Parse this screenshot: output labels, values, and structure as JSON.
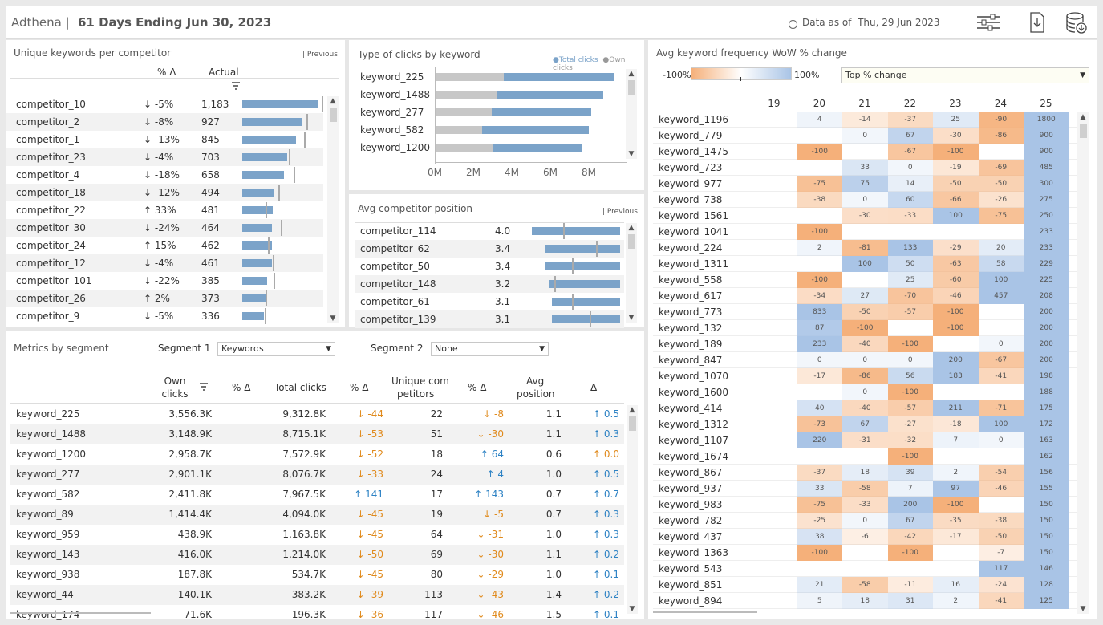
{
  "header": {
    "brand": "Adthena |",
    "date_range": "61 Days Ending Jun 30, 2023",
    "data_as_of_label": "Data as of",
    "data_as_of_date": "Thu, 29 Jun 2023",
    "icons": [
      "filter-sliders-icon",
      "download-pdf-icon",
      "database-download-icon"
    ]
  },
  "unique_keywords": {
    "title": "Unique keywords per competitor",
    "previous_label": "| Previous",
    "col_pct": "% Δ",
    "col_actual": "Actual",
    "max": 1183,
    "rows": [
      {
        "name": "competitor_10",
        "pct": "↓ -5%",
        "actual": "1,183",
        "value": 1183,
        "prev": 1245
      },
      {
        "name": "competitor_2",
        "pct": "↓ -8%",
        "actual": "927",
        "value": 927,
        "prev": 1008
      },
      {
        "name": "competitor_1",
        "pct": "↓ -13%",
        "actual": "845",
        "value": 845,
        "prev": 971
      },
      {
        "name": "competitor_23",
        "pct": "↓ -4%",
        "actual": "703",
        "value": 703,
        "prev": 732
      },
      {
        "name": "competitor_4",
        "pct": "↓ -18%",
        "actual": "658",
        "value": 658,
        "prev": 802
      },
      {
        "name": "competitor_18",
        "pct": "↓ -12%",
        "actual": "494",
        "value": 494,
        "prev": 561
      },
      {
        "name": "competitor_22",
        "pct": "↑ 33%",
        "actual": "481",
        "value": 481,
        "prev": 362
      },
      {
        "name": "competitor_30",
        "pct": "↓ -24%",
        "actual": "464",
        "value": 464,
        "prev": 610
      },
      {
        "name": "competitor_24",
        "pct": "↑ 15%",
        "actual": "462",
        "value": 462,
        "prev": 402
      },
      {
        "name": "competitor_12",
        "pct": "↓ -4%",
        "actual": "461",
        "value": 461,
        "prev": 480
      },
      {
        "name": "competitor_101",
        "pct": "↓ -22%",
        "actual": "385",
        "value": 385,
        "prev": 494
      },
      {
        "name": "competitor_26",
        "pct": "↑ 2%",
        "actual": "373",
        "value": 373,
        "prev": 366
      },
      {
        "name": "competitor_9",
        "pct": "↓ -5%",
        "actual": "336",
        "value": 336,
        "prev": 354
      }
    ]
  },
  "clicks_type": {
    "title": "Type of clicks by keyword",
    "legend_total": "●Total clicks",
    "legend_own": "●Own clicks",
    "ticks": [
      "0M",
      "2M",
      "4M",
      "6M",
      "8M"
    ],
    "tick_values": [
      0,
      2,
      4,
      6,
      8
    ],
    "xmax": 10,
    "rows": [
      {
        "name": "keyword_225",
        "own": 3.56,
        "total": 9.31
      },
      {
        "name": "keyword_1488",
        "own": 3.15,
        "total": 8.72
      },
      {
        "name": "keyword_277",
        "own": 2.9,
        "total": 8.08
      },
      {
        "name": "keyword_582",
        "own": 2.41,
        "total": 7.97
      },
      {
        "name": "keyword_1200",
        "own": 2.96,
        "total": 7.57
      }
    ]
  },
  "avg_position": {
    "title": "Avg competitor position",
    "previous_label": "| Previous",
    "max": 4.0,
    "rows": [
      {
        "name": "competitor_114",
        "value_label": "4.0",
        "value": 4.0,
        "prev": 1.4
      },
      {
        "name": "competitor_62",
        "value_label": "3.4",
        "value": 3.4,
        "prev": 2.9
      },
      {
        "name": "competitor_50",
        "value_label": "3.4",
        "value": 3.4,
        "prev": 1.8
      },
      {
        "name": "competitor_148",
        "value_label": "3.2",
        "value": 3.2,
        "prev": 1.0
      },
      {
        "name": "competitor_61",
        "value_label": "3.1",
        "value": 3.1,
        "prev": 1.8
      },
      {
        "name": "competitor_139",
        "value_label": "3.1",
        "value": 3.1,
        "prev": 2.6
      }
    ]
  },
  "metrics": {
    "title": "Metrics by segment",
    "segment1_label": "Segment 1",
    "segment1_value": "Keywords",
    "segment2_label": "Segment 2",
    "segment2_value": "None",
    "cols": {
      "own1": "Own",
      "own2": "clicks",
      "pct": "% Δ",
      "total": "Total clicks",
      "pct2": "% Δ",
      "uniq1": "Unique com",
      "uniq2": "petitors",
      "pct3": "% Δ",
      "avg1": "Avg",
      "avg2": "position",
      "delta": "Δ"
    },
    "rows": [
      {
        "name": "keyword_225",
        "own": "3,556.3K",
        "total": "9,312.8K",
        "tp": "↓ -44",
        "td": "d",
        "u": "22",
        "up": "↓ -8",
        "ud": "d",
        "avg": "1.1",
        "ad": "↑ 0.5",
        "adc": "u"
      },
      {
        "name": "keyword_1488",
        "own": "3,148.9K",
        "total": "8,715.1K",
        "tp": "↓ -53",
        "td": "d",
        "u": "51",
        "up": "↓ -30",
        "ud": "d",
        "avg": "1.1",
        "ad": "↑ 0.3",
        "adc": "u"
      },
      {
        "name": "keyword_1200",
        "own": "2,958.7K",
        "total": "7,572.9K",
        "tp": "↓ -52",
        "td": "d",
        "u": "18",
        "up": "↑ 64",
        "ud": "u",
        "avg": "0.6",
        "ad": "↑ 0.0",
        "adc": "d"
      },
      {
        "name": "keyword_277",
        "own": "2,901.1K",
        "total": "8,076.7K",
        "tp": "↓ -33",
        "td": "d",
        "u": "24",
        "up": "↑ 4",
        "ud": "u",
        "avg": "1.0",
        "ad": "↑ 0.5",
        "adc": "u"
      },
      {
        "name": "keyword_582",
        "own": "2,411.8K",
        "total": "7,967.5K",
        "tp": "↑ 141",
        "td": "u",
        "u": "17",
        "up": "↑ 143",
        "ud": "u",
        "avg": "0.7",
        "ad": "↑ 0.7",
        "adc": "u"
      },
      {
        "name": "keyword_89",
        "own": "1,414.4K",
        "total": "4,094.0K",
        "tp": "↓ -45",
        "td": "d",
        "u": "19",
        "up": "↓ -5",
        "ud": "d",
        "avg": "0.7",
        "ad": "↑ 0.3",
        "adc": "u"
      },
      {
        "name": "keyword_959",
        "own": "438.9K",
        "total": "1,163.8K",
        "tp": "↓ -45",
        "td": "d",
        "u": "64",
        "up": "↓ -31",
        "ud": "d",
        "avg": "1.0",
        "ad": "↑ 0.3",
        "adc": "u"
      },
      {
        "name": "keyword_143",
        "own": "416.0K",
        "total": "1,214.0K",
        "tp": "↓ -50",
        "td": "d",
        "u": "69",
        "up": "↓ -30",
        "ud": "d",
        "avg": "1.1",
        "ad": "↑ 0.2",
        "adc": "u"
      },
      {
        "name": "keyword_938",
        "own": "187.8K",
        "total": "534.7K",
        "tp": "↓ -45",
        "td": "d",
        "u": "80",
        "up": "↓ -29",
        "ud": "d",
        "avg": "1.0",
        "ad": "↑ 0.1",
        "adc": "u"
      },
      {
        "name": "keyword_44",
        "own": "140.1K",
        "total": "383.2K",
        "tp": "↓ -39",
        "td": "d",
        "u": "113",
        "up": "↓ -43",
        "ud": "d",
        "avg": "1.4",
        "ad": "↑ 0.2",
        "adc": "u"
      },
      {
        "name": "keyword_174",
        "own": "71.6K",
        "total": "196.3K",
        "tp": "↓ -36",
        "td": "d",
        "u": "117",
        "up": "↓ -46",
        "ud": "d",
        "avg": "1.5",
        "ad": "↑ 0.1",
        "adc": "u"
      }
    ]
  },
  "heatmap": {
    "title": "Avg keyword frequency WoW % change",
    "legend_min": "-100%",
    "legend_max": "100%",
    "sort_value": "Top % change",
    "weeks": [
      "19",
      "20",
      "21",
      "22",
      "23",
      "24",
      "25"
    ],
    "rows": [
      {
        "k": "keyword_1196",
        "v": [
          null,
          4,
          -14,
          -37,
          25,
          -90,
          1800
        ]
      },
      {
        "k": "keyword_779",
        "v": [
          null,
          null,
          0,
          67,
          -30,
          -86,
          900
        ]
      },
      {
        "k": "keyword_1475",
        "v": [
          null,
          -100,
          null,
          -67,
          -100,
          null,
          900
        ]
      },
      {
        "k": "keyword_723",
        "v": [
          null,
          null,
          33,
          0,
          -19,
          -69,
          485
        ]
      },
      {
        "k": "keyword_977",
        "v": [
          null,
          -75,
          75,
          14,
          -50,
          -50,
          300
        ]
      },
      {
        "k": "keyword_738",
        "v": [
          null,
          -38,
          0,
          60,
          -66,
          -26,
          275
        ]
      },
      {
        "k": "keyword_1561",
        "v": [
          null,
          null,
          -30,
          -33,
          100,
          -75,
          250
        ]
      },
      {
        "k": "keyword_1041",
        "v": [
          null,
          -100,
          null,
          null,
          null,
          null,
          233
        ]
      },
      {
        "k": "keyword_224",
        "v": [
          null,
          2,
          -81,
          133,
          -29,
          20,
          233
        ]
      },
      {
        "k": "keyword_1311",
        "v": [
          null,
          null,
          100,
          50,
          -63,
          58,
          229
        ]
      },
      {
        "k": "keyword_558",
        "v": [
          null,
          -100,
          null,
          25,
          -60,
          100,
          225
        ]
      },
      {
        "k": "keyword_617",
        "v": [
          null,
          -34,
          27,
          -70,
          -46,
          457,
          208
        ]
      },
      {
        "k": "keyword_773",
        "v": [
          null,
          833,
          -50,
          -57,
          -100,
          null,
          200
        ]
      },
      {
        "k": "keyword_132",
        "v": [
          null,
          87,
          -100,
          null,
          -100,
          null,
          200
        ]
      },
      {
        "k": "keyword_189",
        "v": [
          null,
          233,
          -40,
          -100,
          null,
          0,
          200
        ]
      },
      {
        "k": "keyword_847",
        "v": [
          null,
          0,
          0,
          0,
          200,
          -67,
          200
        ]
      },
      {
        "k": "keyword_1070",
        "v": [
          null,
          -17,
          -86,
          56,
          183,
          -41,
          198
        ]
      },
      {
        "k": "keyword_1600",
        "v": [
          null,
          null,
          0,
          -100,
          null,
          null,
          188
        ]
      },
      {
        "k": "keyword_414",
        "v": [
          null,
          40,
          -40,
          -57,
          211,
          -71,
          175
        ]
      },
      {
        "k": "keyword_1312",
        "v": [
          null,
          -73,
          67,
          -27,
          -18,
          100,
          172
        ]
      },
      {
        "k": "keyword_1107",
        "v": [
          null,
          220,
          -31,
          -32,
          7,
          0,
          163
        ]
      },
      {
        "k": "keyword_1674",
        "v": [
          null,
          null,
          null,
          -100,
          null,
          null,
          162
        ]
      },
      {
        "k": "keyword_867",
        "v": [
          null,
          -37,
          18,
          39,
          2,
          -54,
          156
        ]
      },
      {
        "k": "keyword_937",
        "v": [
          null,
          33,
          -58,
          7,
          97,
          -46,
          155
        ]
      },
      {
        "k": "keyword_983",
        "v": [
          null,
          -75,
          -33,
          200,
          -100,
          null,
          150
        ]
      },
      {
        "k": "keyword_782",
        "v": [
          null,
          -25,
          0,
          67,
          -35,
          -38,
          150
        ]
      },
      {
        "k": "keyword_437",
        "v": [
          null,
          38,
          -6,
          -42,
          -17,
          -50,
          150
        ]
      },
      {
        "k": "keyword_1363",
        "v": [
          null,
          -100,
          null,
          -100,
          null,
          -7,
          150
        ]
      },
      {
        "k": "keyword_543",
        "v": [
          null,
          null,
          null,
          null,
          null,
          117,
          146
        ]
      },
      {
        "k": "keyword_851",
        "v": [
          null,
          21,
          -58,
          -11,
          16,
          -24,
          128
        ]
      },
      {
        "k": "keyword_894",
        "v": [
          null,
          5,
          18,
          31,
          2,
          -41,
          125
        ]
      }
    ]
  },
  "colors": {
    "bar": "#7ba3c9",
    "neg": "#f5b07a",
    "pos": "#a9c4e6",
    "down": "#e08a1c",
    "up": "#2d82c4"
  }
}
